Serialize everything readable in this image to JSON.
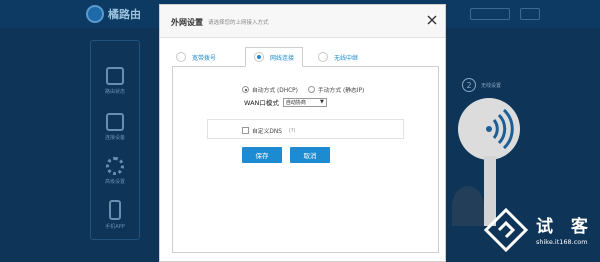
{
  "background": {
    "app_name": "橘路由",
    "step_number": "2",
    "step_label": "无线设置",
    "sidebar": [
      {
        "label": "路由状态",
        "icon": "router-status-icon"
      },
      {
        "label": "连接设备",
        "icon": "devices-icon"
      },
      {
        "label": "高级设置",
        "icon": "gear-icon"
      },
      {
        "label": "手机APP",
        "icon": "phone-icon"
      }
    ]
  },
  "dialog": {
    "title": "外网设置",
    "subtitle": "请选择您的上网接入方式",
    "close_icon": "close-icon",
    "tabs": [
      {
        "label": "宽带拨号",
        "selected": false
      },
      {
        "label": "网线连接",
        "selected": true
      },
      {
        "label": "无线中继",
        "selected": false
      }
    ],
    "ip_mode": {
      "auto_label": "自动方式 (DHCP)",
      "manual_label": "手动方式 (静态IP)",
      "selected": "auto"
    },
    "wan_mode": {
      "label": "WAN口模式",
      "value": "自动协商"
    },
    "custom_dns": {
      "label": "自定义DNS",
      "hint": "(?)",
      "checked": false
    },
    "save_label": "保存",
    "cancel_label": "取消"
  },
  "watermark": {
    "text": "试 客",
    "url": "shike.it168.com"
  },
  "colors": {
    "accent": "#1d8bd1",
    "overlay_bg": "#0e3457"
  }
}
